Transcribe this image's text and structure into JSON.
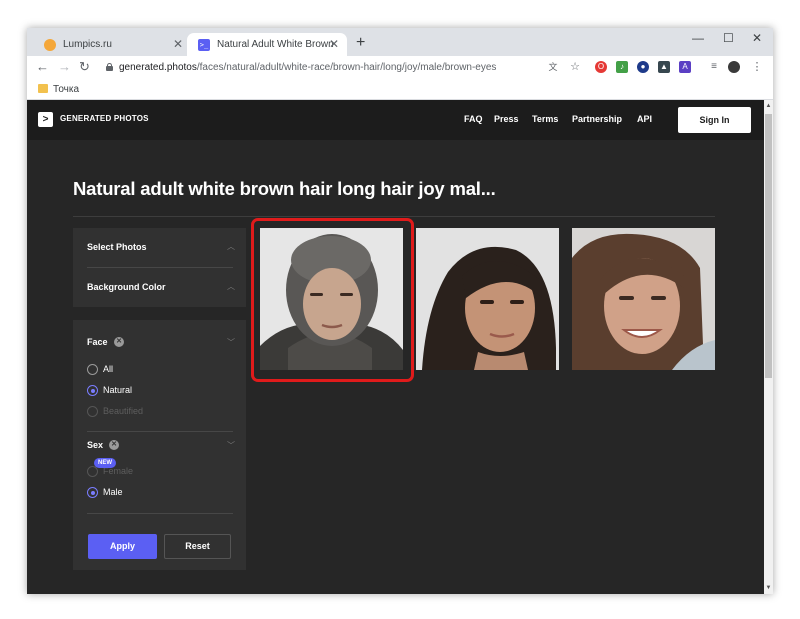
{
  "browser": {
    "tabs": [
      {
        "title": "Lumpics.ru",
        "active": false,
        "favicon": "orange-circle-icon"
      },
      {
        "title": "Natural Adult White Brown Hair L",
        "active": true,
        "favicon": "generated-photos-icon"
      }
    ],
    "url_host": "generated.photos",
    "url_path": "/faces/natural/adult/white-race/brown-hair/long/joy/male/brown-eyes",
    "bookmark": "Точка"
  },
  "site": {
    "logo_mark": ">",
    "logo_text": "GENERATED PHOTOS",
    "nav": [
      "FAQ",
      "Press",
      "Terms",
      "Partnership",
      "API"
    ],
    "sign_in": "Sign In"
  },
  "main": {
    "title": "Natural adult white brown hair long hair joy mal..."
  },
  "sidebar": {
    "select_photos": "Select Photos",
    "background_color": "Background Color",
    "face": {
      "title": "Face",
      "options": [
        {
          "label": "All",
          "selected": false,
          "enabled": true
        },
        {
          "label": "Natural",
          "selected": true,
          "enabled": true,
          "badge": "NEW"
        },
        {
          "label": "Beautified",
          "selected": false,
          "enabled": false
        }
      ]
    },
    "sex": {
      "title": "Sex",
      "options": [
        {
          "label": "Female",
          "selected": false,
          "enabled": false
        },
        {
          "label": "Male",
          "selected": true,
          "enabled": true
        }
      ]
    },
    "apply": "Apply",
    "reset": "Reset"
  },
  "colors": {
    "accent": "#5b5ff3",
    "highlight": "#e01b1b",
    "page_bg": "#262626",
    "panel_bg": "#313131"
  }
}
